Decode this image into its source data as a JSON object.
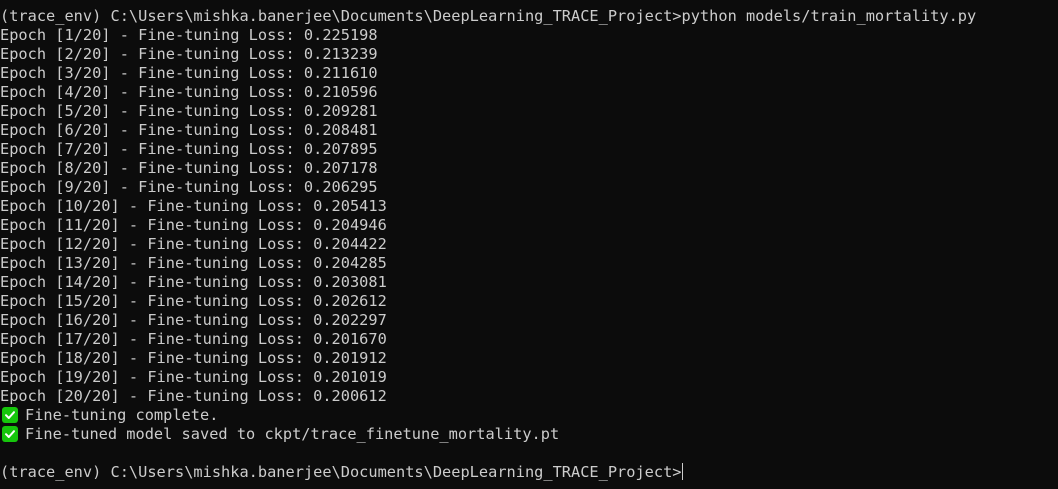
{
  "terminal": {
    "command_prompt": "(trace_env) C:\\Users\\mishka.banerjee\\Documents\\DeepLearning_TRACE_Project>",
    "command": "python models/train_mortality.py",
    "output_lines": [
      "Epoch [1/20] - Fine-tuning Loss: 0.225198",
      "Epoch [2/20] - Fine-tuning Loss: 0.213239",
      "Epoch [3/20] - Fine-tuning Loss: 0.211610",
      "Epoch [4/20] - Fine-tuning Loss: 0.210596",
      "Epoch [5/20] - Fine-tuning Loss: 0.209281",
      "Epoch [6/20] - Fine-tuning Loss: 0.208481",
      "Epoch [7/20] - Fine-tuning Loss: 0.207895",
      "Epoch [8/20] - Fine-tuning Loss: 0.207178",
      "Epoch [9/20] - Fine-tuning Loss: 0.206295",
      "Epoch [10/20] - Fine-tuning Loss: 0.205413",
      "Epoch [11/20] - Fine-tuning Loss: 0.204946",
      "Epoch [12/20] - Fine-tuning Loss: 0.204422",
      "Epoch [13/20] - Fine-tuning Loss: 0.204285",
      "Epoch [14/20] - Fine-tuning Loss: 0.203081",
      "Epoch [15/20] - Fine-tuning Loss: 0.202612",
      "Epoch [16/20] - Fine-tuning Loss: 0.202297",
      "Epoch [17/20] - Fine-tuning Loss: 0.201670",
      "Epoch [18/20] - Fine-tuning Loss: 0.201912",
      "Epoch [19/20] - Fine-tuning Loss: 0.201019",
      "Epoch [20/20] - Fine-tuning Loss: 0.200612"
    ],
    "status_lines": [
      {
        "icon": "check-mark-icon",
        "text": "Fine-tuning complete."
      },
      {
        "icon": "check-mark-icon",
        "text": "Fine-tuned model saved to ckpt/trace_finetune_mortality.pt"
      }
    ],
    "final_prompt": "(trace_env) C:\\Users\\mishka.banerjee\\Documents\\DeepLearning_TRACE_Project>"
  },
  "colors": {
    "background": "#0c0c0c",
    "foreground": "#cccccc",
    "check_green": "#16c60c"
  }
}
